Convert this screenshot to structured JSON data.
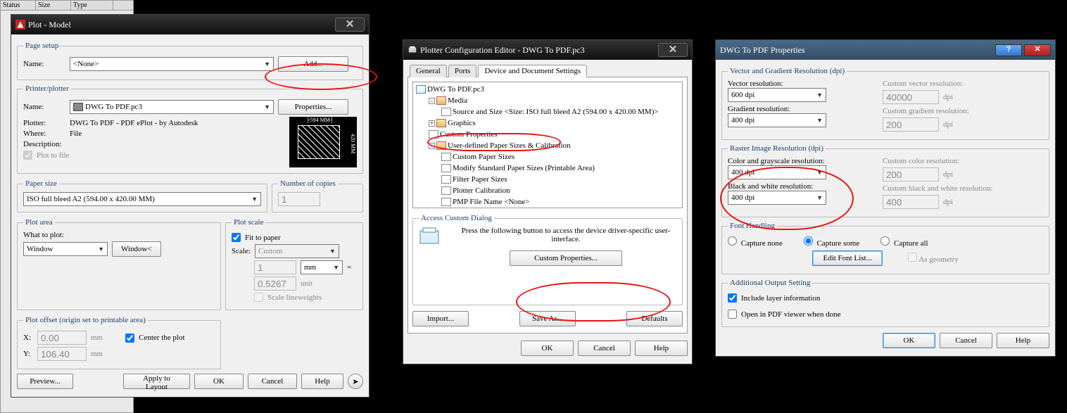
{
  "bgtable_cols": [
    "Status",
    "Size",
    "Type"
  ],
  "plot_dlg": {
    "title": "Plot - Model",
    "page_setup": {
      "legend": "Page setup",
      "name_lbl": "Name:",
      "name_val": "<None>",
      "add_btn": "Add..."
    },
    "printer": {
      "legend": "Printer/plotter",
      "name_lbl": "Name:",
      "name_val": "DWG To PDF.pc3",
      "properties_btn": "Properties...",
      "plotter_lbl": "Plotter:",
      "plotter_val": "DWG To PDF - PDF ePlot - by Autodesk",
      "where_lbl": "Where:",
      "where_val": "File",
      "desc_lbl": "Description:",
      "plot_to_file": "Plot to file",
      "preview_w": "594 MM",
      "preview_h": "420 MM"
    },
    "paper": {
      "legend": "Paper size",
      "size": "ISO full bleed A2 (594.00 x 420.00 MM)",
      "copies_legend": "Number of copies",
      "copies": "1"
    },
    "area": {
      "legend": "Plot area",
      "what_lbl": "What to plot:",
      "what_val": "Window",
      "window_btn": "Window<"
    },
    "scale": {
      "legend": "Plot scale",
      "fit": "Fit to paper",
      "scale_lbl": "Scale:",
      "scale_val": "Custom",
      "num": "1",
      "unit": "mm",
      "equals": "=",
      "denom": "0.5267",
      "unit2": "unit",
      "lineweights": "Scale lineweights"
    },
    "offset": {
      "legend": "Plot offset (origin set to printable area)",
      "x_lbl": "X:",
      "x_val": "0.00",
      "x_unit": "mm",
      "y_lbl": "Y:",
      "y_val": "106.40",
      "y_unit": "mm",
      "center": "Center the plot"
    },
    "buttons": {
      "preview": "Preview...",
      "apply": "Apply to Layout",
      "ok": "OK",
      "cancel": "Cancel",
      "help": "Help"
    }
  },
  "config_dlg": {
    "title": "Plotter Configuration Editor - DWG To PDF.pc3",
    "tabs": {
      "general": "General",
      "ports": "Ports",
      "device": "Device and Document Settings"
    },
    "tree": {
      "root": "DWG To PDF.pc3",
      "media": "Media",
      "source": "Source and Size <Size: ISO full bleed A2 (594.00 x 420.00 MM)>",
      "graphics": "Graphics",
      "custom_props": "Custom Properties",
      "userdef": "User-defined Paper Sizes & Calibration",
      "custom_sizes": "Custom Paper Sizes",
      "modify": "Modify Standard Paper Sizes (Printable Area)",
      "filter": "Filter Paper Sizes",
      "calib": "Plotter Calibration",
      "pmp": "PMP File Name <None>"
    },
    "access": {
      "legend": "Access Custom Dialog",
      "text": "Press the following button to access the device driver-specific user-interface.",
      "btn": "Custom Properties..."
    },
    "import_btn": "Import...",
    "saveas_btn": "Save As...",
    "defaults_btn": "Defaults",
    "ok": "OK",
    "cancel": "Cancel",
    "help": "Help"
  },
  "props_dlg": {
    "title": "DWG To PDF Properties",
    "vg": {
      "legend": "Vector and Gradient Resolution (dpi)",
      "vec_lbl": "Vector resolution:",
      "vec_val": "600 dpi",
      "vec_custom_lbl": "Custom vector resolution:",
      "vec_custom_val": "40000",
      "grad_lbl": "Gradient resolution:",
      "grad_val": "400 dpi",
      "grad_custom_lbl": "Custom gradient resolution:",
      "grad_custom_val": "200",
      "unit": "dpi"
    },
    "ri": {
      "legend": "Raster Image Resolution (dpi)",
      "color_lbl": "Color and grayscale resolution:",
      "color_val": "400 dpi",
      "color_custom_lbl": "Custom color resolution:",
      "color_custom_val": "200",
      "bw_lbl": "Black and white resolution:",
      "bw_val": "400 dpi",
      "bw_custom_lbl": "Custom black and white resolution:",
      "bw_custom_val": "400",
      "unit": "dpi"
    },
    "font": {
      "legend": "Font Handling",
      "none": "Capture none",
      "some": "Capture some",
      "all": "Capture all",
      "edit": "Edit Font List...",
      "asgeom": "As geometry"
    },
    "addl": {
      "legend": "Additional Output Setting",
      "layer": "Include layer information",
      "open": "Open in PDF viewer when done"
    },
    "ok": "OK",
    "cancel": "Cancel",
    "help": "Help"
  }
}
